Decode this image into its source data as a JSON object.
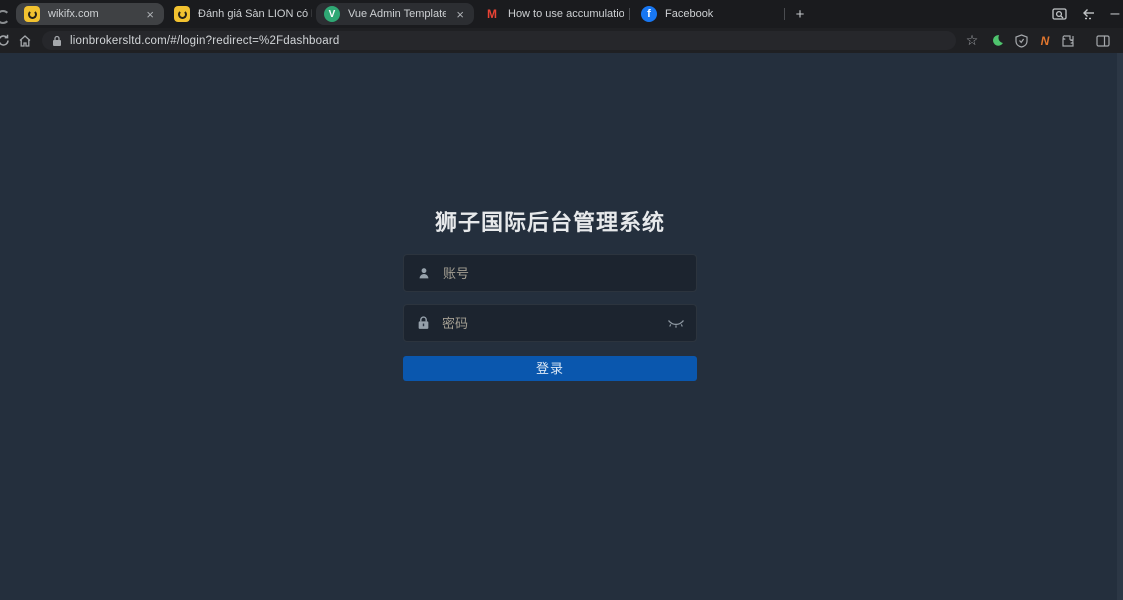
{
  "browser": {
    "tabs": [
      {
        "title": "wikifx.com",
        "favicon": "wikifx",
        "closable": true,
        "state": "highlighted"
      },
      {
        "title": "Đánh giá Sàn LION có lừa đảo kh",
        "favicon": "wikifx",
        "closable": false,
        "state": "inactive"
      },
      {
        "title": "Vue Admin Template",
        "favicon": "vue",
        "closable": true,
        "state": "active"
      },
      {
        "title": "How to use accumulation, manipu",
        "favicon": "gmail",
        "closable": false,
        "state": "inactive"
      },
      {
        "title": "Facebook",
        "favicon": "facebook",
        "closable": false,
        "state": "inactive"
      }
    ],
    "glyphs": {
      "close": "×",
      "new_tab": "+",
      "minimize": "–",
      "star": "☆",
      "vue_letter": "V",
      "gmail_letter": "M",
      "facebook_letter": "f",
      "extension_n": "N"
    },
    "address_bar": {
      "url": "lionbrokersltd.com/#/login?redirect=%2Fdashboard"
    },
    "colors": {
      "wikifx_yellow": "#f2c230",
      "vue_green": "#2fa874",
      "facebook_blue": "#1877f2",
      "gmail_red": "#ea4335",
      "dark_reader_green": "#4ec36d"
    }
  },
  "page": {
    "title": "狮子国际后台管理系统",
    "form": {
      "username_placeholder": "账号",
      "password_placeholder": "密码",
      "login_button": "登录"
    },
    "colors": {
      "background": "#242f3d",
      "button_blue": "#0a57ae"
    }
  }
}
